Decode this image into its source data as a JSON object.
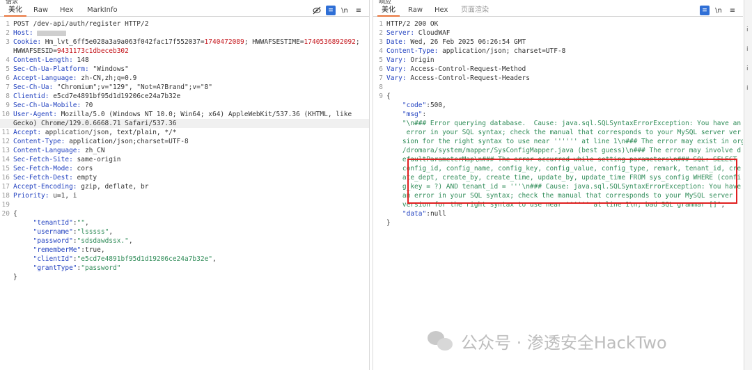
{
  "left": {
    "title": "请求",
    "tabs": [
      {
        "label": "美化",
        "active": true
      },
      {
        "label": "Raw"
      },
      {
        "label": "Hex"
      },
      {
        "label": "MarkInfo"
      }
    ],
    "tools": {
      "eye_slash": "eye-slash-icon",
      "wrap": "≡",
      "newline": "\\n",
      "menu": "≡"
    },
    "lines": [
      {
        "n": "1",
        "t": "POST /dev-api/auth/register HTTP/2"
      },
      {
        "n": "2",
        "k": "Host:",
        "v": "redacted"
      },
      {
        "n": "3",
        "k": "Cookie:",
        "v": " Hm_lvt_6ff5e028a3a9a063f042fac17f552037=",
        "c": "1740472089",
        "v2": "; HWWAFSESTIME=",
        "c2": "1740536892092",
        "v3": ";"
      },
      {
        "n": "",
        "k": "",
        "v": "HWWAFSESID=",
        "c": "9431173c1dbeceb302"
      },
      {
        "n": "4",
        "k": "Content-Length:",
        "v": " 148"
      },
      {
        "n": "5",
        "k": "Sec-Ch-Ua-Platform:",
        "v": " \"Windows\""
      },
      {
        "n": "6",
        "k": "Accept-Language:",
        "v": " zh-CN,zh;q=0.9"
      },
      {
        "n": "7",
        "k": "Sec-Ch-Ua:",
        "v": " \"Chromium\";v=\"129\", \"Not=A?Brand\";v=\"8\""
      },
      {
        "n": "8",
        "k": "Clientid:",
        "v": " e5cd7e4891bf95d1d19206ce24a7b32e"
      },
      {
        "n": "9",
        "k": "Sec-Ch-Ua-Mobile:",
        "v": " ?0"
      },
      {
        "n": "10",
        "k": "User-Agent:",
        "v": " Mozilla/5.0 (Windows NT 10.0; Win64; x64) AppleWebKit/537.36 (KHTML, like"
      },
      {
        "n": "",
        "k": "",
        "v": "Gecko) Chrome/129.0.6668.71 Safari/537.36",
        "hl": true
      },
      {
        "n": "11",
        "k": "Accept:",
        "v": " application/json, text/plain, */*"
      },
      {
        "n": "12",
        "k": "Content-Type:",
        "v": " application/json;charset=UTF-8"
      },
      {
        "n": "13",
        "k": "Content-Language:",
        "v": " zh_CN"
      },
      {
        "n": "14",
        "k": "Sec-Fetch-Site:",
        "v": " same-origin"
      },
      {
        "n": "15",
        "k": "Sec-Fetch-Mode:",
        "v": " cors"
      },
      {
        "n": "16",
        "k": "Sec-Fetch-Dest:",
        "v": " empty"
      },
      {
        "n": "17",
        "k": "Accept-Encoding:",
        "v": " gzip, deflate, br"
      },
      {
        "n": "18",
        "k": "Priority:",
        "v": " u=1, i"
      },
      {
        "n": "19",
        "t": ""
      },
      {
        "n": "20",
        "t": "{"
      },
      {
        "n": "",
        "indent": "     ",
        "p": "\"tenantId\"",
        "v": ":",
        "s": "\"\"",
        "v2": ","
      },
      {
        "n": "",
        "indent": "     ",
        "p": "\"username\"",
        "v": ":",
        "s": "\"lsssss\"",
        "v2": ","
      },
      {
        "n": "",
        "indent": "     ",
        "p": "\"password\"",
        "v": ":",
        "s": "\"sdsdawdssx.\"",
        "v2": ","
      },
      {
        "n": "",
        "indent": "     ",
        "p": "\"rememberMe\"",
        "v": ":true,"
      },
      {
        "n": "",
        "indent": "     ",
        "p": "\"clientId\"",
        "v": ":",
        "s": "\"e5cd7e4891bf95d1d19206ce24a7b32e\"",
        "v2": ","
      },
      {
        "n": "",
        "indent": "     ",
        "p": "\"grantType\"",
        "v": ":",
        "s": "\"password\""
      },
      {
        "n": "",
        "t": "}"
      }
    ]
  },
  "right": {
    "title": "响应",
    "tabs": [
      {
        "label": "美化",
        "active": true
      },
      {
        "label": "Raw"
      },
      {
        "label": "Hex"
      },
      {
        "label": "页面渲染",
        "dim": true
      }
    ],
    "tools": {
      "wrap": "≡",
      "newline": "\\n",
      "menu": "≡"
    },
    "lines": [
      {
        "n": "1",
        "t": "HTTP/2 200 OK"
      },
      {
        "n": "2",
        "k": "Server:",
        "v": " CloudWAF"
      },
      {
        "n": "3",
        "k": "Date:",
        "v": " Wed, 26 Feb 2025 06:26:54 GMT"
      },
      {
        "n": "4",
        "k": "Content-Type:",
        "v": " application/json; charset=UTF-8"
      },
      {
        "n": "5",
        "k": "Vary:",
        "v": " Origin"
      },
      {
        "n": "6",
        "k": "Vary:",
        "v": " Access-Control-Request-Method"
      },
      {
        "n": "7",
        "k": "Vary:",
        "v": " Access-Control-Request-Headers"
      },
      {
        "n": "8",
        "t": ""
      },
      {
        "n": "9",
        "t": "{"
      },
      {
        "n": "",
        "indent": "    ",
        "p": "\"code\"",
        "v": ":500,"
      },
      {
        "n": "",
        "indent": "    ",
        "p": "\"msg\"",
        "v": ":"
      },
      {
        "n": "",
        "indent": "    ",
        "s": "\"\\n### Error querying database.  Cause: java.sql.SQLSyntaxErrorException: You have an"
      },
      {
        "n": "",
        "indent": "     ",
        "s": "error in your SQL syntax; check the manual that corresponds to your MySQL server ver"
      },
      {
        "n": "",
        "indent": "    ",
        "s": "sion for the right syntax to use near '''''' at line 1\\n### The error may exist in org"
      },
      {
        "n": "",
        "indent": "    ",
        "s": "/dromara/system/mapper/SysConfigMapper.java (best guess)\\n### The error may involve d"
      },
      {
        "n": "",
        "indent": "    ",
        "s": "efaultParameterMap\\n### The error occurred while setting parameters\\n### SQL: SELECT"
      },
      {
        "n": "",
        "indent": "    ",
        "s": "config_id, config_name, config_key, config_value, config_type, remark, tenant_id, cre"
      },
      {
        "n": "",
        "indent": "    ",
        "s": "ate_dept, create_by, create_time, update_by, update_time FROM sys_config WHERE (confi"
      },
      {
        "n": "",
        "indent": "    ",
        "s": "g_key = ?) AND tenant_id = '''\\n### Cause: java.sql.SQLSyntaxErrorException: You have"
      },
      {
        "n": "",
        "indent": "    ",
        "s": "an error in your SQL syntax; check the manual that corresponds to your MySQL server"
      },
      {
        "n": "",
        "indent": "    ",
        "s": "version for the right syntax to use near '''''' at line 1\\n; bad SQL grammar []\"",
        "v2": ","
      },
      {
        "n": "",
        "indent": "    ",
        "p": "\"data\"",
        "v": ":null"
      },
      {
        "n": "",
        "t": "}"
      }
    ]
  },
  "watermark": {
    "text": "公众号 · 渗透安全HackTwo"
  },
  "colors": {
    "key": "#1f3fbf",
    "cookie_value": "#c4161c",
    "string": "#2e8b57",
    "highlight_box": "#e02020",
    "active_tab": "#e8743b"
  }
}
